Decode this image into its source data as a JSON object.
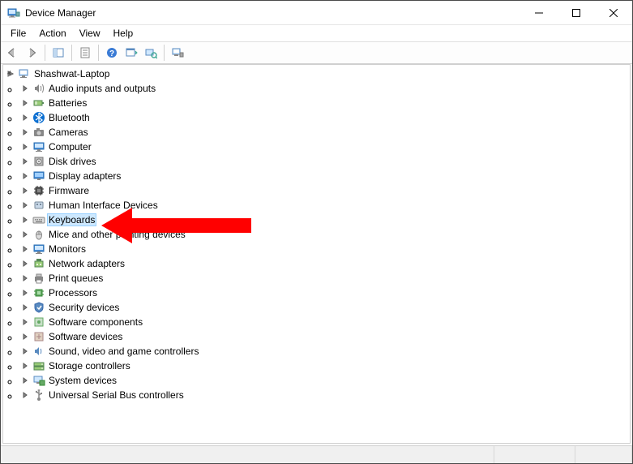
{
  "window": {
    "title": "Device Manager"
  },
  "menu": {
    "file": "File",
    "action": "Action",
    "view": "View",
    "help": "Help"
  },
  "toolbar": {
    "back": "back-icon",
    "forward": "forward-icon",
    "show_hide": "show-hide-tree-icon",
    "properties": "properties-icon",
    "help": "help-icon",
    "refresh": "refresh-pane-icon",
    "scan": "scan-hardware-icon",
    "devices": "devices-printers-icon"
  },
  "tree": {
    "root": "Shashwat-Laptop",
    "nodes": [
      {
        "id": "audio",
        "label": "Audio inputs and outputs",
        "icon": "speaker"
      },
      {
        "id": "batteries",
        "label": "Batteries",
        "icon": "battery"
      },
      {
        "id": "bluetooth",
        "label": "Bluetooth",
        "icon": "bluetooth"
      },
      {
        "id": "cameras",
        "label": "Cameras",
        "icon": "camera"
      },
      {
        "id": "computer",
        "label": "Computer",
        "icon": "monitor"
      },
      {
        "id": "disk",
        "label": "Disk drives",
        "icon": "disk"
      },
      {
        "id": "display",
        "label": "Display adapters",
        "icon": "display"
      },
      {
        "id": "firmware",
        "label": "Firmware",
        "icon": "chip"
      },
      {
        "id": "hid",
        "label": "Human Interface Devices",
        "icon": "hid"
      },
      {
        "id": "keyboards",
        "label": "Keyboards",
        "icon": "keyboard",
        "selected": true
      },
      {
        "id": "mice",
        "label": "Mice and other pointing devices",
        "icon": "mouse"
      },
      {
        "id": "monitors",
        "label": "Monitors",
        "icon": "monitor"
      },
      {
        "id": "network",
        "label": "Network adapters",
        "icon": "network"
      },
      {
        "id": "printq",
        "label": "Print queues",
        "icon": "printer"
      },
      {
        "id": "processors",
        "label": "Processors",
        "icon": "cpu"
      },
      {
        "id": "security",
        "label": "Security devices",
        "icon": "shield"
      },
      {
        "id": "swcomp",
        "label": "Software components",
        "icon": "swcomp"
      },
      {
        "id": "swdev",
        "label": "Software devices",
        "icon": "swdev"
      },
      {
        "id": "sound",
        "label": "Sound, video and game controllers",
        "icon": "sound"
      },
      {
        "id": "storage",
        "label": "Storage controllers",
        "icon": "storage"
      },
      {
        "id": "system",
        "label": "System devices",
        "icon": "system"
      },
      {
        "id": "usb",
        "label": "Universal Serial Bus controllers",
        "icon": "usb"
      }
    ]
  },
  "annotation": {
    "highlights": "keyboards",
    "color": "#ff0000"
  }
}
